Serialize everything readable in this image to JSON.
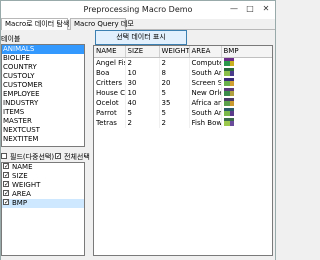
{
  "window": {
    "title": "Preprocessing Macro Demo"
  },
  "tabs": [
    "Macro로 데이터 탐색 데모",
    "Macro Query 데모"
  ],
  "left": {
    "table_list_label": "테이블",
    "tables": [
      "ANIMALS",
      "BIOLIFE",
      "COUNTRY",
      "CUSTOLY",
      "CUSTOMER",
      "EMPLOYEE",
      "INDUSTRY",
      "ITEMS",
      "MASTER",
      "NEXTCUST",
      "NEXTITEM"
    ],
    "field_list_label": "필드(다중선택)",
    "select_all_label": "전체선택",
    "fields": [
      "NAME",
      "SIZE",
      "WEIGHT",
      "AREA",
      "BMP"
    ]
  },
  "show_button_label": "선택 데이터 표시",
  "grid": {
    "columns": [
      "NAME",
      "SIZE",
      "WEIGHT",
      "AREA",
      "BMP"
    ],
    "rows": [
      [
        "Angel Fish",
        "2",
        "2",
        "Computer..."
      ],
      [
        "Boa",
        "10",
        "8",
        "South Am..."
      ],
      [
        "Critters",
        "30",
        "20",
        "Screen Sa..."
      ],
      [
        "House Cat",
        "10",
        "5",
        "New Orle..."
      ],
      [
        "Ocelot",
        "40",
        "35",
        "Africa and..."
      ],
      [
        "Parrot",
        "5",
        "5",
        "South Am..."
      ],
      [
        "Tetras",
        "2",
        "2",
        "Fish Bowls"
      ]
    ],
    "bmp_colors": [
      [
        "#6a2a8a",
        "#2a9a4a",
        "#c8b020"
      ],
      [
        "#2a6a3a",
        "#8ac04a",
        "#4a3a8a"
      ],
      [
        "#3a2a7a",
        "#6ab04a",
        "#d0a030"
      ],
      [
        "#5a3a7a",
        "#3a8a4a",
        "#b0a040"
      ],
      [
        "#4a3a6a",
        "#5aa04a",
        "#c89a30"
      ],
      [
        "#2a5a6a",
        "#7ab84a",
        "#5a3a8a"
      ],
      [
        "#3a6a4a",
        "#9ac84a",
        "#6a4a9a"
      ]
    ]
  }
}
